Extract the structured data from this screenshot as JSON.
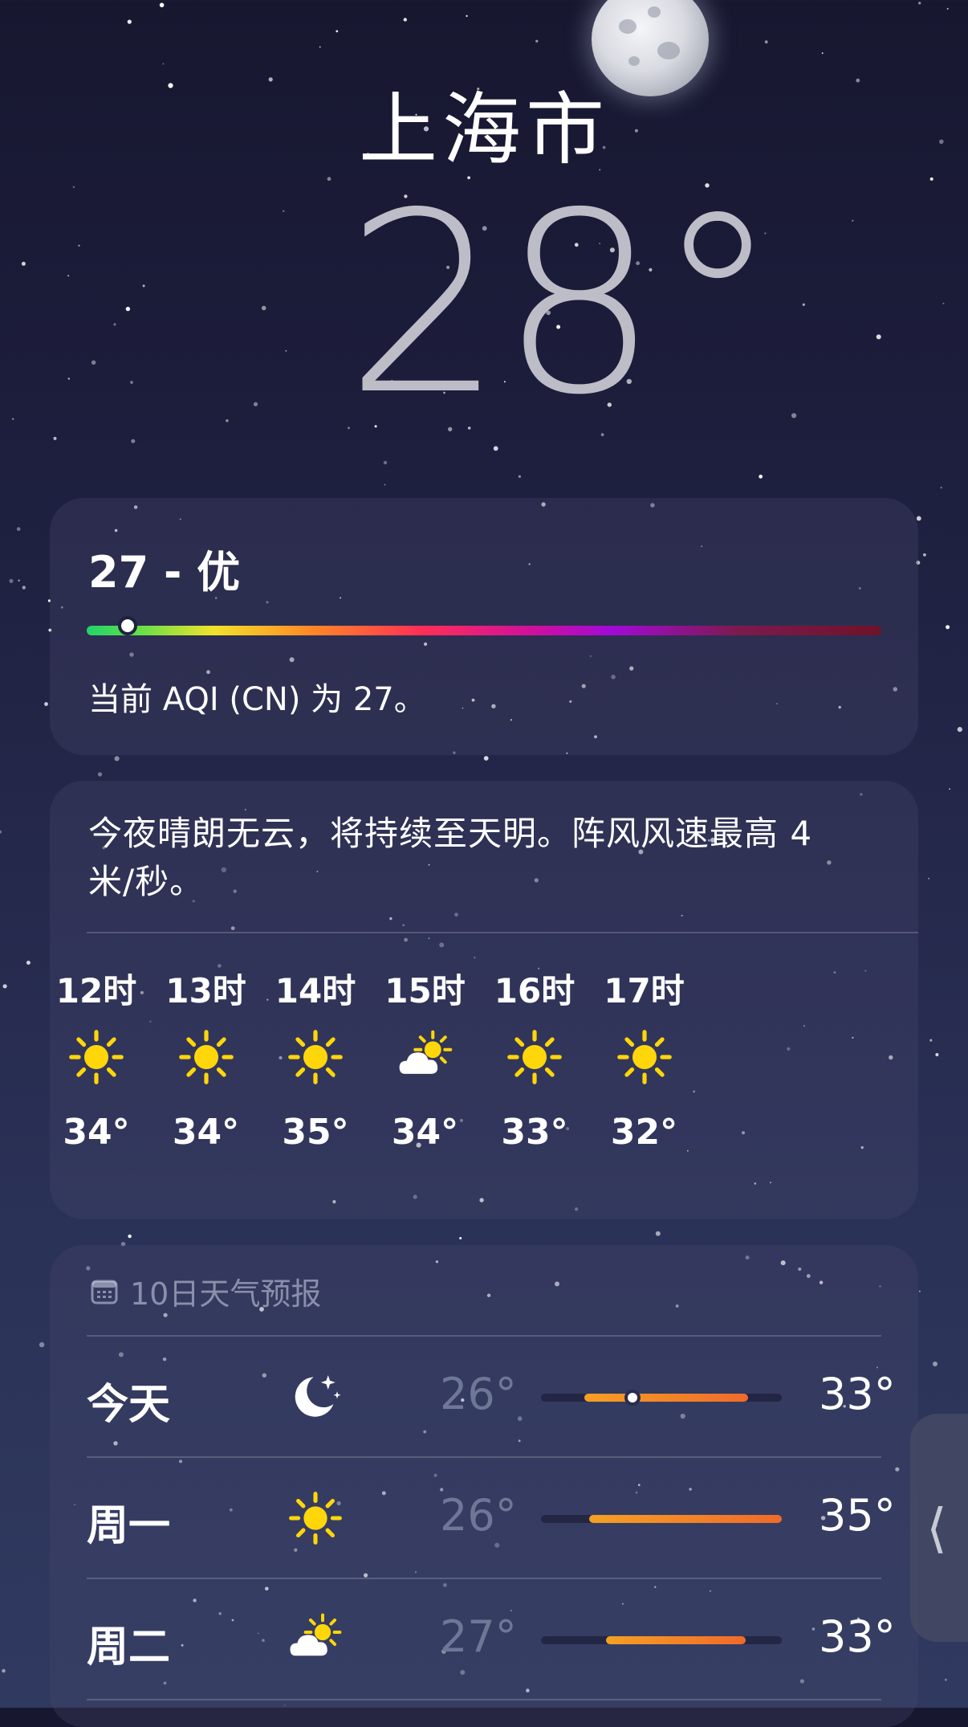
{
  "location": {
    "city": "上海市",
    "temperature": "28°"
  },
  "aqi": {
    "title": "27 - 优",
    "description": "当前 AQI (CN) 为 27。",
    "indicator_fraction": 0.052
  },
  "hourly": {
    "summary": "今夜晴朗无云，将持续至天明。阵风风速最高 4 米/秒。",
    "hours": [
      {
        "label": "12时",
        "icon": "sun-icon",
        "temp": "34°"
      },
      {
        "label": "13时",
        "icon": "sun-icon",
        "temp": "34°"
      },
      {
        "label": "14时",
        "icon": "sun-icon",
        "temp": "35°"
      },
      {
        "label": "15时",
        "icon": "partly-cloudy-icon",
        "temp": "34°"
      },
      {
        "label": "16时",
        "icon": "sun-icon",
        "temp": "33°"
      },
      {
        "label": "17时",
        "icon": "sun-icon",
        "temp": "32°"
      }
    ]
  },
  "forecast": {
    "header": "10日天气预报",
    "days": [
      {
        "day": "今天",
        "icon": "moon-stars-icon",
        "low": "26°",
        "high": "33°",
        "range_start": 0.18,
        "range_end": 0.86,
        "current": 0.38
      },
      {
        "day": "周一",
        "icon": "sun-icon",
        "low": "26°",
        "high": "35°",
        "range_start": 0.2,
        "range_end": 1.0
      },
      {
        "day": "周二",
        "icon": "partly-cloudy-icon",
        "low": "27°",
        "high": "33°",
        "range_start": 0.27,
        "range_end": 0.85
      }
    ]
  },
  "colors": {
    "sun": "#FFD60A",
    "range_start": "#F5A024",
    "range_end": "#F06A2A"
  }
}
